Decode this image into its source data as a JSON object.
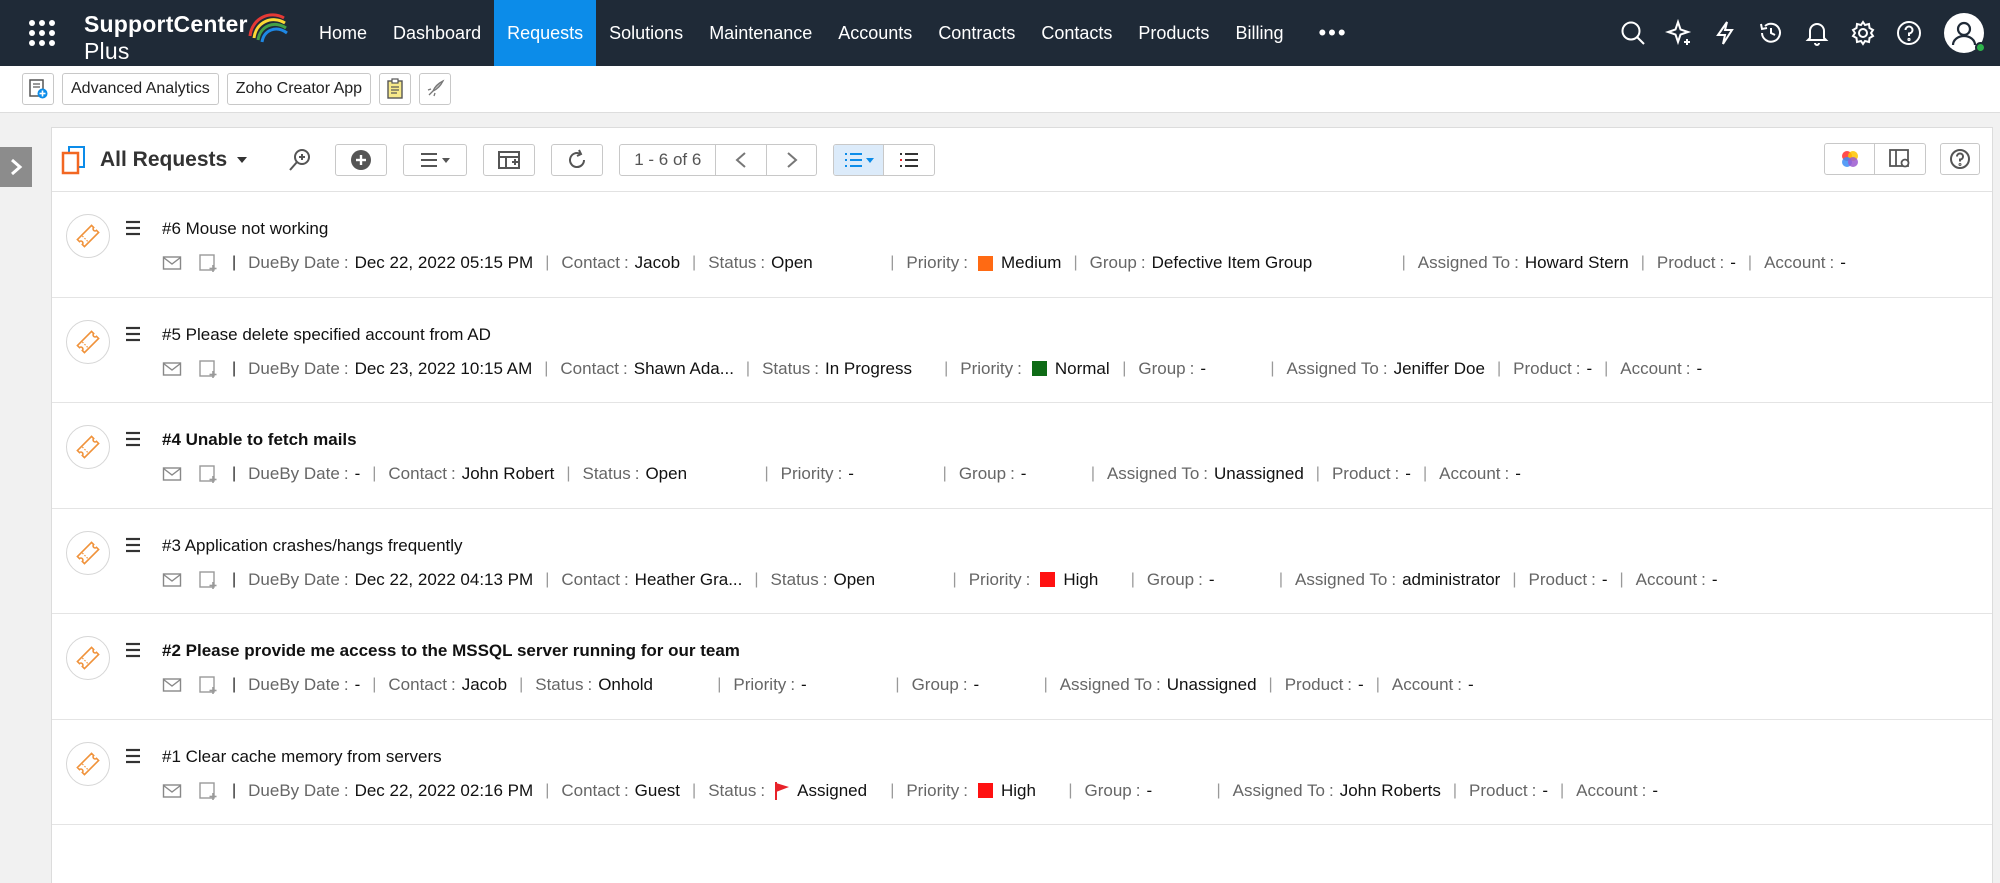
{
  "brand": {
    "logo_text": "SupportCenter",
    "logo_plus": " Plus"
  },
  "nav": {
    "items": [
      "Home",
      "Dashboard",
      "Requests",
      "Solutions",
      "Maintenance",
      "Accounts",
      "Contracts",
      "Contacts",
      "Products",
      "Billing"
    ],
    "active": "Requests",
    "more": "•••"
  },
  "toolbar": {
    "advanced_analytics": "Advanced Analytics",
    "zoho_creator": "Zoho Creator App"
  },
  "list": {
    "view_title": "All Requests",
    "page_count": "1 - 6 of 6"
  },
  "labels": {
    "dueby": "DueBy Date",
    "contact": "Contact",
    "status": "Status",
    "priority": "Priority",
    "group": "Group",
    "assigned": "Assigned To",
    "product": "Product",
    "account": "Account",
    "colon": ":",
    "pipe": "|"
  },
  "colors": {
    "Medium": "#ff6a13",
    "Normal": "#0e6b16",
    "High": "#ff1111",
    "accent": "#0c8ce9",
    "flag": "#e8222a"
  },
  "requests": [
    {
      "subject": "#6 Mouse not working",
      "bold": false,
      "dueby": "Dec 22, 2022 05:15 PM",
      "contact": "Jacob",
      "status": "Open",
      "status_flag": false,
      "priority": "Medium",
      "group": "Defective Item Group",
      "assigned": "Howard Stern",
      "product": "-",
      "account": "-"
    },
    {
      "subject": "#5 Please delete specified account from AD",
      "bold": false,
      "dueby": "Dec 23, 2022 10:15 AM",
      "contact": "Shawn Ada...",
      "status": "In Progress",
      "status_flag": false,
      "priority": "Normal",
      "group": "-",
      "assigned": "Jeniffer Doe",
      "product": "-",
      "account": "-"
    },
    {
      "subject": "#4 Unable to fetch mails",
      "bold": true,
      "dueby": "-",
      "contact": "John Robert",
      "status": "Open",
      "status_flag": false,
      "priority": "-",
      "group": "-",
      "assigned": "Unassigned",
      "product": "-",
      "account": "-"
    },
    {
      "subject": "#3 Application crashes/hangs frequently",
      "bold": false,
      "dueby": "Dec 22, 2022 04:13 PM",
      "contact": "Heather Gra...",
      "status": "Open",
      "status_flag": false,
      "priority": "High",
      "group": "-",
      "assigned": "administrator",
      "product": "-",
      "account": "-"
    },
    {
      "subject": "#2 Please provide me access to the MSSQL server running for our team",
      "bold": true,
      "dueby": "-",
      "contact": "Jacob",
      "status": "Onhold",
      "status_flag": false,
      "priority": "-",
      "group": "-",
      "assigned": "Unassigned",
      "product": "-",
      "account": "-"
    },
    {
      "subject": "#1 Clear cache memory from servers",
      "bold": false,
      "dueby": "Dec 22, 2022 02:16 PM",
      "contact": "Guest",
      "status": "Assigned",
      "status_flag": true,
      "priority": "High",
      "group": "-",
      "assigned": "John Roberts",
      "product": "-",
      "account": "-"
    }
  ]
}
